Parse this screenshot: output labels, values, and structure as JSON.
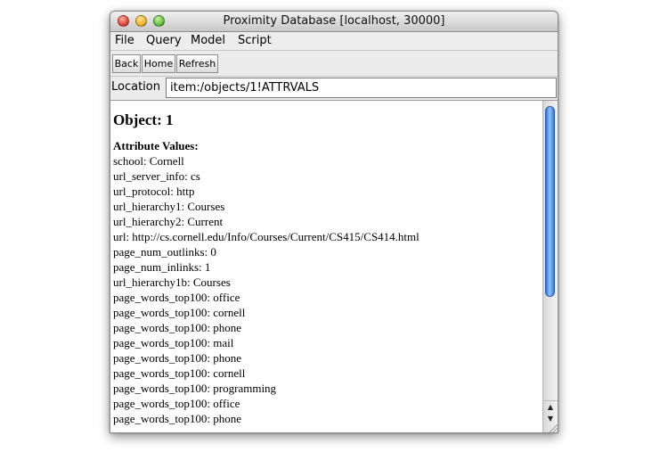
{
  "window": {
    "title": "Proximity Database [localhost, 30000]"
  },
  "menu": [
    "File",
    "Query",
    "Model",
    "Script"
  ],
  "toolbar": {
    "back": "Back",
    "home": "Home",
    "refresh": "Refresh"
  },
  "location": {
    "label": "Location",
    "value": "item:/objects/1!ATTRVALS"
  },
  "content": {
    "heading": "Object: 1",
    "attr_heading": "Attribute Values:",
    "attributes": [
      "school: Cornell",
      "url_server_info: cs",
      "url_protocol: http",
      "url_hierarchy1: Courses",
      "url_hierarchy2: Current",
      "url: http://cs.cornell.edu/Info/Courses/Current/CS415/CS414.html",
      "page_num_outlinks: 0",
      "page_num_inlinks: 1",
      "url_hierarchy1b: Courses",
      "page_words_top100: office",
      "page_words_top100: cornell",
      "page_words_top100: phone",
      "page_words_top100: mail",
      "page_words_top100: phone",
      "page_words_top100: cornell",
      "page_words_top100: programming",
      "page_words_top100: office",
      "page_words_top100: phone"
    ]
  },
  "icons": {
    "close": "close-button-icon",
    "minimize": "minimize-button-icon",
    "zoom": "zoom-button-icon",
    "scroll_up": "arrow-up-icon",
    "scroll_down": "arrow-down-icon",
    "resize": "resize-grip-icon"
  }
}
